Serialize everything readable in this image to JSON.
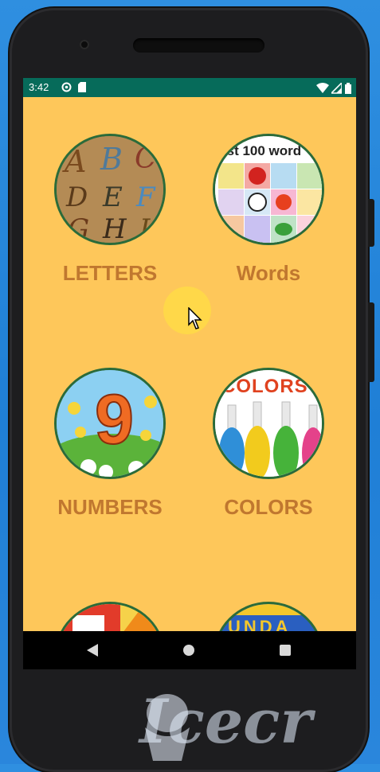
{
  "status_bar": {
    "time": "3:42",
    "icons": [
      "sync-icon",
      "sd-card-icon"
    ],
    "right_icons": [
      "wifi-icon",
      "signal-icon",
      "battery-icon"
    ]
  },
  "tiles": [
    {
      "label": "LETTERS",
      "image": "alphabet-letters-image"
    },
    {
      "label": "Words",
      "image": "first-100-words-image",
      "banner_text": "rst 100 word"
    },
    {
      "label": "NUMBERS",
      "image": "number-nine-cartoon-image"
    },
    {
      "label": "COLORS",
      "image": "colored-balls-image",
      "banner_text": "COLORS"
    },
    {
      "label": "",
      "image": "shapes-image"
    },
    {
      "label": "",
      "image": "days-image",
      "banner_text": "UNDA"
    }
  ],
  "navigation": {
    "back": "back-button",
    "home": "home-button",
    "recents": "recents-button"
  },
  "watermark": {
    "text": "Icecr"
  },
  "colors": {
    "screen_background": "#fec75a",
    "status_bar": "#066b5a",
    "label": "#c0772f"
  }
}
